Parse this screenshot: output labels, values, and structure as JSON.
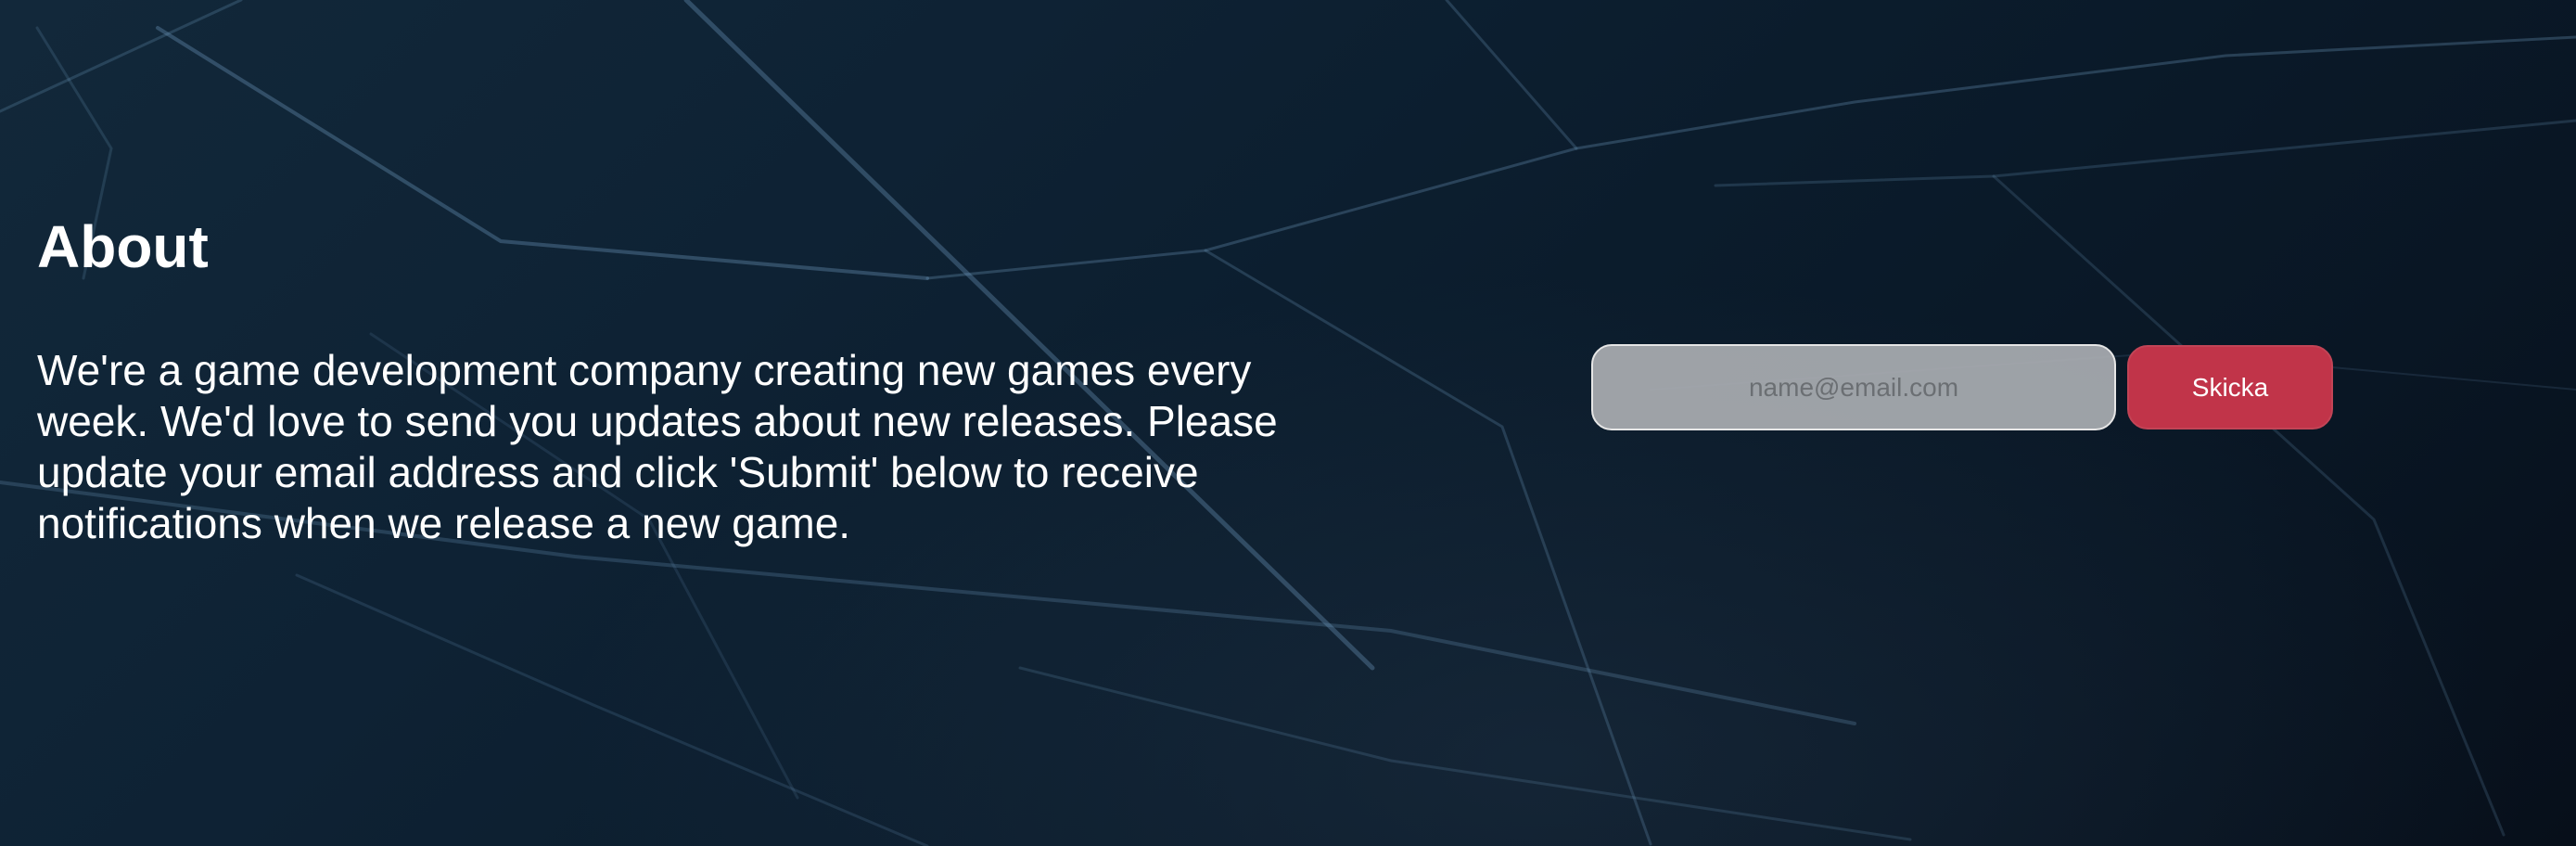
{
  "about": {
    "title": "About",
    "description": "We're a game development company creating new games every week. We'd love to send you updates about new releases. Please update your email address and click 'Submit' below to receive notifications when we release a new game."
  },
  "signup": {
    "email_placeholder": "name@email.com",
    "email_value": "",
    "submit_label": "Skicka"
  },
  "colors": {
    "background": "#0b1c2c",
    "button": "#c13449",
    "input": "#a8acb0",
    "text": "#ffffff"
  }
}
